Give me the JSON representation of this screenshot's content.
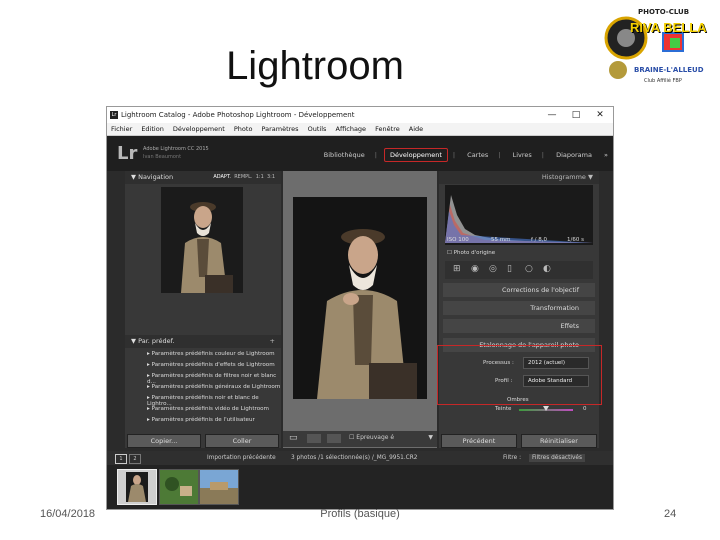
{
  "slide": {
    "title": "Lightroom",
    "date": "16/04/2018",
    "caption": "Profils (basique)",
    "page_number": "24"
  },
  "logo": {
    "line1": "PHOTO-CLUB",
    "line2": "RIVA BELLA",
    "line3": "BRAINE-L'ALLEUD",
    "line4": "Club Affilié FBP"
  },
  "window": {
    "title": "Lightroom Catalog - Adobe Photoshop Lightroom - Développement",
    "icon_label": "Lr",
    "controls": {
      "minimize": "—",
      "maximize": "□",
      "close": "✕"
    },
    "menu": [
      "Fichier",
      "Edition",
      "Développement",
      "Photo",
      "Paramètres",
      "Outils",
      "Affichage",
      "Fenêtre",
      "Aide"
    ]
  },
  "identity": {
    "logo": "Lr",
    "product": "Adobe Lightroom CC 2015",
    "user": "Ivan Beaumont"
  },
  "modules": {
    "items": [
      "Bibliothèque",
      "Développement",
      "Cartes",
      "Livres",
      "Diaporama"
    ],
    "active": "Développement",
    "more": "»"
  },
  "navigator": {
    "title": "Navigation",
    "options": [
      "ADAPT.",
      "REMPL.",
      "1:1",
      "3:1"
    ]
  },
  "presets": {
    "title": "Par. prédef.",
    "add": "+",
    "items": [
      "Paramètres prédéfinis couleur de Lightroom",
      "Paramètres prédéfinis d'effets de Lightroom",
      "Paramètres prédéfinis de filtres noir et blanc d...",
      "Paramètres prédéfinis généraux de Lightroom",
      "Paramètres prédéfinis noir et blanc de Lightro...",
      "Paramètres prédéfinis vidéo de Lightroom",
      "Paramètres prédéfinis de l'utilisateur"
    ]
  },
  "left_buttons": {
    "copy": "Copier...",
    "paste": "Coller"
  },
  "histogram": {
    "title": "Histogramme",
    "iso": "ISO 100",
    "focal": "55 mm",
    "aperture": "f / 8,0",
    "shutter": "1/60 s",
    "original_photo": "Photo d'origine"
  },
  "right_sections": [
    "Corrections de l'objectif",
    "Transformation",
    "Effets"
  ],
  "calibration": {
    "title": "Etalonnage de l'appareil photo",
    "process_label": "Processus :",
    "process_value": "2012 (actuel)",
    "profile_label": "Profil :",
    "profile_value": "Adobe Standard",
    "shadows_label": "Ombres",
    "tint_label": "Teinte",
    "tint_value": "0"
  },
  "right_buttons": {
    "previous": "Précédent",
    "reset": "Réinitialiser"
  },
  "toolbar": {
    "softproof": "Epreuvage é"
  },
  "filmstrip": {
    "pages": [
      "1",
      "2"
    ],
    "source": "Importation précédente",
    "info": "3 photos /1 sélectionnée(s) /_MG_9951.CR2",
    "filter_label": "Filtre :",
    "filter_value": "Filtres désactivés"
  },
  "colors": {
    "highlight_red": "#c62828",
    "panel_bg": "#383838",
    "chrome_dark": "#2b2b2b"
  }
}
